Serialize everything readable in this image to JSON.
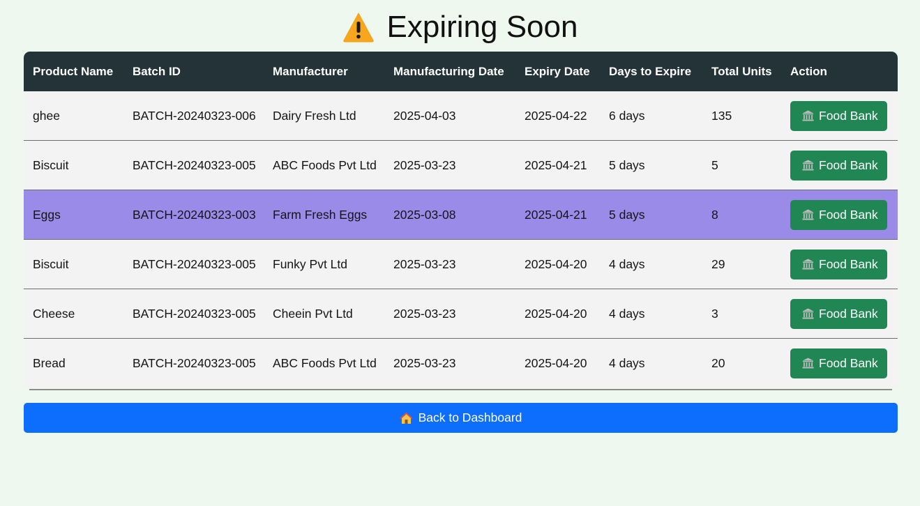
{
  "page": {
    "title": "Expiring Soon",
    "title_icon": "warning-icon"
  },
  "table": {
    "headers": [
      "Product Name",
      "Batch ID",
      "Manufacturer",
      "Manufacturing Date",
      "Expiry Date",
      "Days to Expire",
      "Total Units",
      "Action"
    ],
    "rows": [
      {
        "product": "ghee",
        "batch": "BATCH-20240323-006",
        "manufacturer": "Dairy Fresh Ltd",
        "mfg_date": "2025-04-03",
        "expiry": "2025-04-22",
        "days": "6 days",
        "units": "135",
        "highlighted": false
      },
      {
        "product": "Biscuit",
        "batch": "BATCH-20240323-005",
        "manufacturer": "ABC Foods Pvt Ltd",
        "mfg_date": "2025-03-23",
        "expiry": "2025-04-21",
        "days": "5 days",
        "units": "5",
        "highlighted": false
      },
      {
        "product": "Eggs",
        "batch": "BATCH-20240323-003",
        "manufacturer": "Farm Fresh Eggs",
        "mfg_date": "2025-03-08",
        "expiry": "2025-04-21",
        "days": "5 days",
        "units": "8",
        "highlighted": true
      },
      {
        "product": "Biscuit",
        "batch": "BATCH-20240323-005",
        "manufacturer": "Funky Pvt Ltd",
        "mfg_date": "2025-03-23",
        "expiry": "2025-04-20",
        "days": "4 days",
        "units": "29",
        "highlighted": false
      },
      {
        "product": "Cheese",
        "batch": "BATCH-20240323-005",
        "manufacturer": "Cheein Pvt Ltd",
        "mfg_date": "2025-03-23",
        "expiry": "2025-04-20",
        "days": "4 days",
        "units": "3",
        "highlighted": false
      },
      {
        "product": "Bread",
        "batch": "BATCH-20240323-005",
        "manufacturer": "ABC Foods Pvt Ltd",
        "mfg_date": "2025-03-23",
        "expiry": "2025-04-20",
        "days": "4 days",
        "units": "20",
        "highlighted": false
      }
    ],
    "action_label": "Food Bank",
    "action_icon": "bank-icon"
  },
  "footer": {
    "back_label": "Back to Dashboard",
    "back_icon": "house-icon"
  },
  "colors": {
    "page_bg": "#eff8ee",
    "header_bg": "#233337",
    "row_bg": "#f4f3f3",
    "highlight_bg": "#9a8be9",
    "action_green": "#1f8654",
    "back_blue": "#0d6efd",
    "warning_amber": "#f7a61e"
  }
}
